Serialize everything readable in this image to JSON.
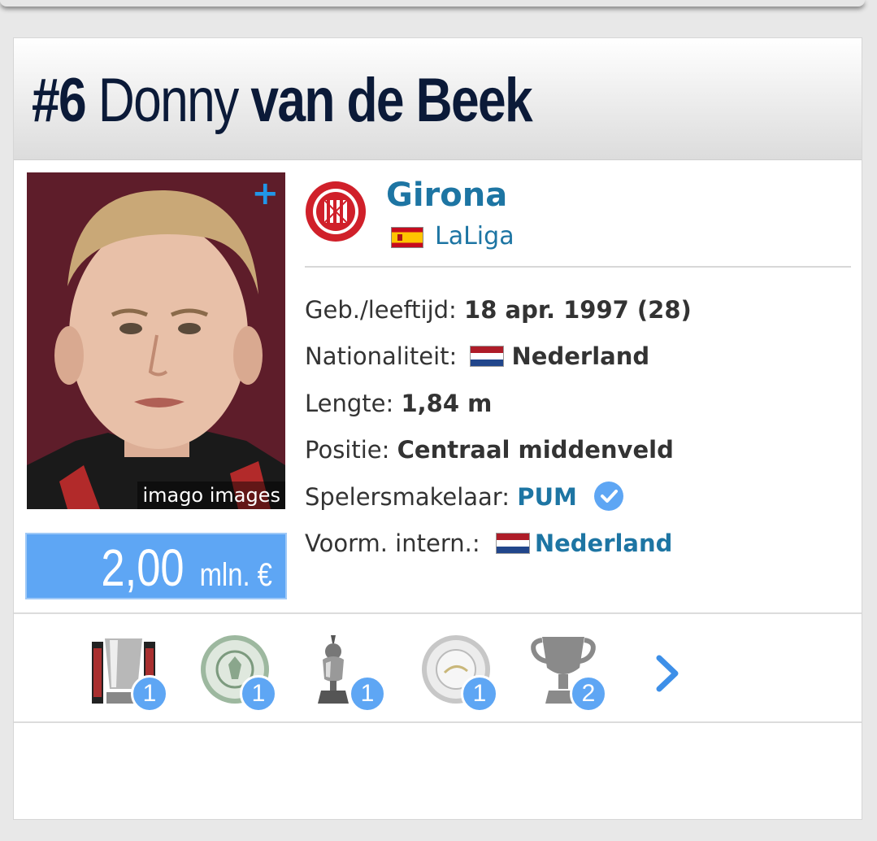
{
  "header": {
    "shirt_number": "#6",
    "first_name": "Donny",
    "last_name": "van de Beek"
  },
  "photo": {
    "credit": "imago images",
    "expand_icon": "plus-icon"
  },
  "market_value": {
    "amount": "2,00",
    "unit": "mln. €"
  },
  "club": {
    "name": "Girona",
    "league": "LaLiga",
    "league_flag": "flag-spain-icon"
  },
  "details": [
    {
      "label": "Geb./leeftijd:",
      "value": "18 apr. 1997 (28)"
    },
    {
      "label": "Nationaliteit:",
      "value": "Nederland"
    },
    {
      "label": "Lengte:",
      "value": "1,84 m"
    },
    {
      "label": "Positie:",
      "value": "Centraal middenveld"
    },
    {
      "label": "Spelersmakelaar:",
      "value": "PUM"
    },
    {
      "label": "Voorm. intern.:",
      "value": "Nederland"
    }
  ],
  "trophies": [
    {
      "name": "league-cup-trophy-icon",
      "count": "1"
    },
    {
      "name": "shield-plate-trophy-icon",
      "count": "1"
    },
    {
      "name": "cup-trophy-icon",
      "count": "1"
    },
    {
      "name": "silver-plate-trophy-icon",
      "count": "1"
    },
    {
      "name": "generic-cup-trophy-icon",
      "count": "2"
    }
  ],
  "colors": {
    "title": "#0b1a38",
    "link": "#1d75a3",
    "accent": "#5ea6f4"
  }
}
